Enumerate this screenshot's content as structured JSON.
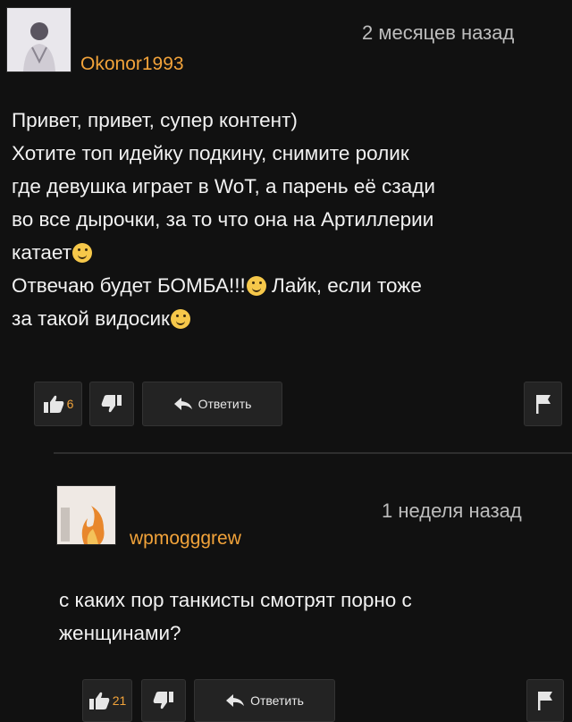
{
  "comment1": {
    "username": "Okonor1993",
    "time": "2 месяцев назад",
    "lines": [
      "Привет, привет, супер контент)",
      "Хотите топ идейку подкину, снимите ролик",
      "где девушка играет в WoT, а парень её сзади",
      "во все дырочки, за то что она на Артиллерии",
      "катает",
      "Отвечаю будет БОМБА!!!",
      "Лайк, если тоже",
      "за такой видосик"
    ],
    "likes": "6",
    "reply_label": "Ответить"
  },
  "comment2": {
    "username": "wpmogggrew",
    "time": "1 неделя назад",
    "lines": [
      "с каких пор танкисты смотрят порно с",
      "женщинами?"
    ],
    "likes": "21",
    "reply_label": "Ответить"
  },
  "icons": {
    "like": "thumbs-up-icon",
    "dislike": "thumbs-down-icon",
    "reply": "reply-arrow-icon",
    "flag": "flag-icon",
    "emoji": "smiley-emoji-icon"
  },
  "colors": {
    "background": "#111111",
    "username": "#f2a33a",
    "text": "#f2f2f2",
    "muted": "#bdbdbd",
    "button": "#232323"
  }
}
